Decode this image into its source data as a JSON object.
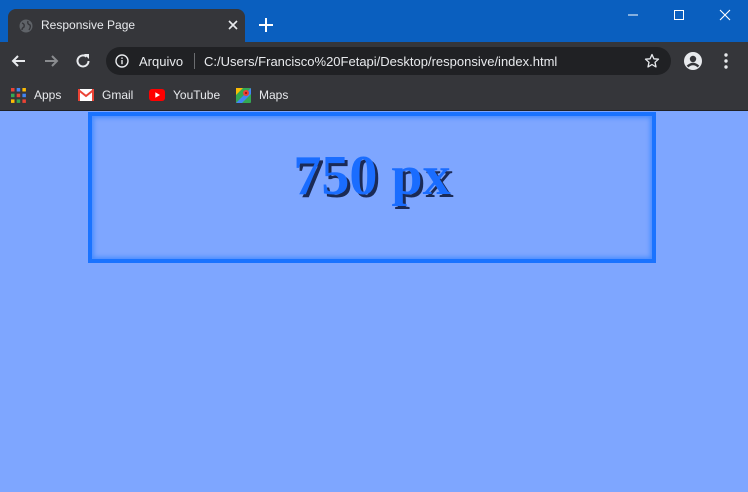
{
  "browser": {
    "tab": {
      "title": "Responsive Page",
      "icon": "globe-icon"
    },
    "toolbar": {
      "scheme_label": "Arquivo",
      "url": "C:/Users/Francisco%20Fetapi/Desktop/responsive/index.html"
    },
    "bookmarks": [
      {
        "label": "Apps",
        "icon": "apps-grid-icon"
      },
      {
        "label": "Gmail",
        "icon": "gmail-icon"
      },
      {
        "label": "YouTube",
        "icon": "youtube-icon"
      },
      {
        "label": "Maps",
        "icon": "maps-icon"
      }
    ],
    "colors": {
      "titlebar": "#0a5fbf",
      "toolbar": "#35363a",
      "omnibox": "#202124"
    }
  },
  "page": {
    "heading": "750 px",
    "colors": {
      "background": "#7ea6ff",
      "border": "#1a73ff",
      "heading": "#1a6dff"
    }
  }
}
